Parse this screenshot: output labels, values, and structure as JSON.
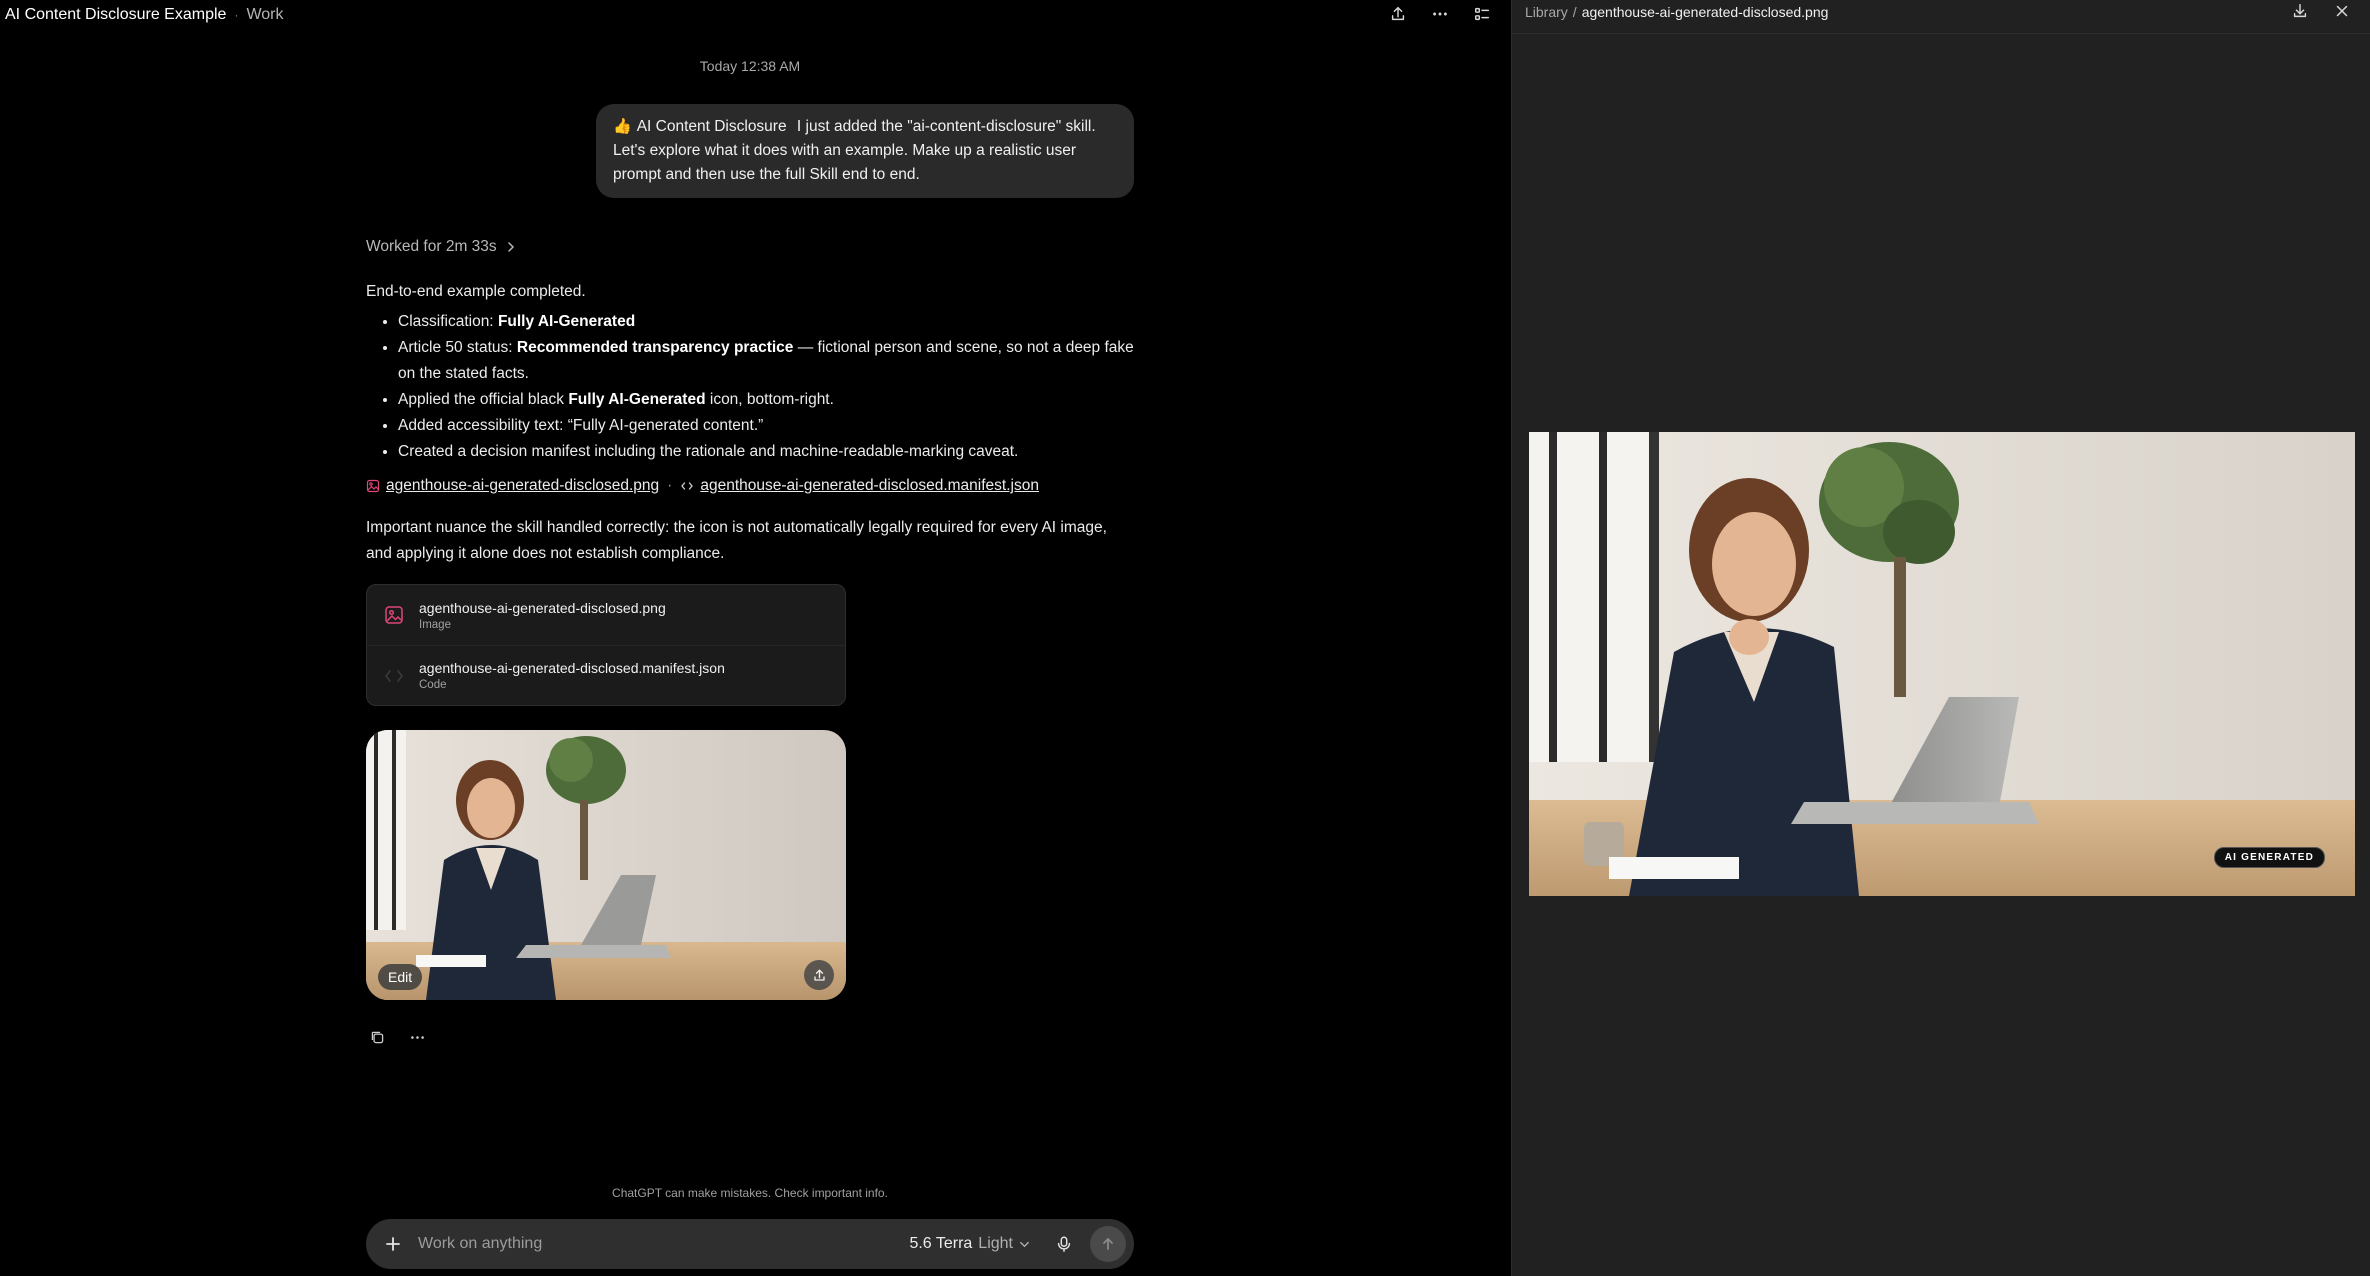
{
  "window": {
    "title": "AI Content Disclosure Example",
    "project": "Work"
  },
  "chat": {
    "timestamp": "Today 12:38 AM",
    "user_message": {
      "skill_label": "AI Content Disclosure",
      "text": "I just added the \"ai-content-disclosure\" skill. Let's explore what it does with an example. Make up a realistic user prompt and then use the full Skill end to end."
    },
    "worked_for": "Worked for 2m 33s",
    "answer": {
      "intro": "End-to-end example completed.",
      "bullets": [
        {
          "pre": "Classification: ",
          "bold": "Fully AI-Generated",
          "post": ""
        },
        {
          "pre": "Article 50 status: ",
          "bold": "Recommended transparency practice",
          "post": " — fictional person and scene, so not a deep fake on the stated facts."
        },
        {
          "pre": "Applied the official black ",
          "bold": "Fully AI-Generated",
          "post": " icon, bottom-right."
        },
        {
          "pre": "Added accessibility text: “Fully AI-generated content.”",
          "bold": "",
          "post": ""
        },
        {
          "pre": "Created a decision manifest including the rationale and machine-readable-marking caveat.",
          "bold": "",
          "post": ""
        }
      ],
      "links": {
        "image": "agenthouse-ai-generated-disclosed.png",
        "separator": "·",
        "manifest": "agenthouse-ai-generated-disclosed.manifest.json"
      },
      "nuance": "Important nuance the skill handled correctly: the icon is not automatically legally required for every AI image, and applying it alone does not establish compliance."
    },
    "attachments": [
      {
        "name": "agenthouse-ai-generated-disclosed.png",
        "kind": "Image",
        "icon": "image-icon"
      },
      {
        "name": "agenthouse-ai-generated-disclosed.manifest.json",
        "kind": "Code",
        "icon": "code-icon"
      }
    ],
    "thumbnail": {
      "edit_label": "Edit"
    },
    "disclaimer": "ChatGPT can make mistakes. Check important info.",
    "composer": {
      "placeholder": "Work on anything",
      "model_name": "5.6 Terra",
      "model_variant": "Light"
    }
  },
  "preview": {
    "breadcrumb_root": "Library",
    "breadcrumb_sep": "/",
    "file_name": "agenthouse-ai-generated-disclosed.png",
    "badge_text": "AI GENERATED"
  },
  "colors": {
    "accent_pink": "#e0457a",
    "bg": "#000000",
    "preview_bg": "#212121",
    "bubble": "#2a2a2a"
  }
}
